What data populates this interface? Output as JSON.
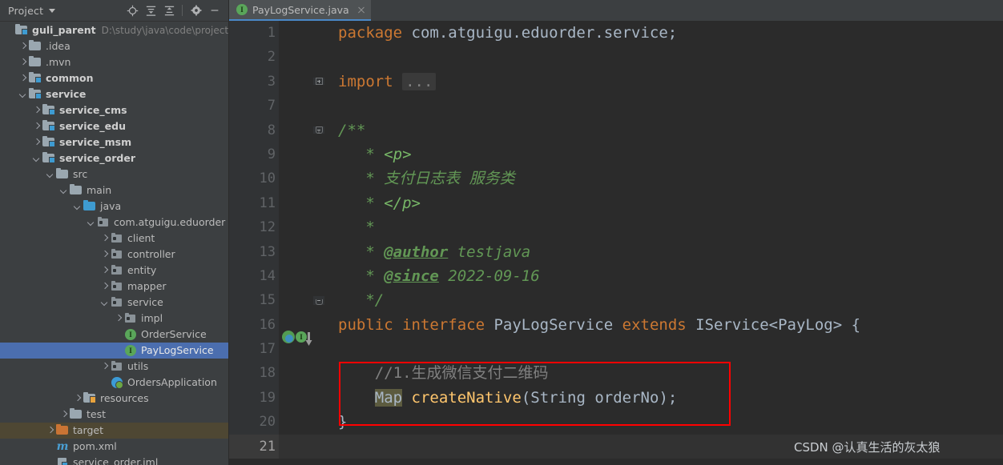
{
  "panel": {
    "title": "Project",
    "icons": [
      {
        "name": "locate-icon"
      },
      {
        "name": "expand-all-icon"
      },
      {
        "name": "collapse-all-icon"
      },
      {
        "name": "settings-gear-icon"
      },
      {
        "name": "minimize-icon"
      }
    ]
  },
  "tree": [
    {
      "label": "guli_parent",
      "path": "D:\\study\\java\\code\\project\\guli_",
      "indent": 0,
      "arrow": "none",
      "icon": "module-folder",
      "bold": true
    },
    {
      "label": ".idea",
      "indent": 1,
      "arrow": "right",
      "icon": "folder"
    },
    {
      "label": ".mvn",
      "indent": 1,
      "arrow": "right",
      "icon": "folder"
    },
    {
      "label": "common",
      "indent": 1,
      "arrow": "right",
      "icon": "module-folder",
      "bold": true
    },
    {
      "label": "service",
      "indent": 1,
      "arrow": "down",
      "icon": "module-folder",
      "bold": true
    },
    {
      "label": "service_cms",
      "indent": 2,
      "arrow": "right",
      "icon": "module-folder",
      "bold": true
    },
    {
      "label": "service_edu",
      "indent": 2,
      "arrow": "right",
      "icon": "module-folder",
      "bold": true
    },
    {
      "label": "service_msm",
      "indent": 2,
      "arrow": "right",
      "icon": "module-folder",
      "bold": true
    },
    {
      "label": "service_order",
      "indent": 2,
      "arrow": "down",
      "icon": "module-folder",
      "bold": true
    },
    {
      "label": "src",
      "indent": 3,
      "arrow": "down",
      "icon": "folder"
    },
    {
      "label": "main",
      "indent": 4,
      "arrow": "down",
      "icon": "folder"
    },
    {
      "label": "java",
      "indent": 5,
      "arrow": "down",
      "icon": "source-folder"
    },
    {
      "label": "com.atguigu.eduorder",
      "indent": 6,
      "arrow": "down",
      "icon": "package"
    },
    {
      "label": "client",
      "indent": 7,
      "arrow": "right",
      "icon": "package"
    },
    {
      "label": "controller",
      "indent": 7,
      "arrow": "right",
      "icon": "package"
    },
    {
      "label": "entity",
      "indent": 7,
      "arrow": "right",
      "icon": "package"
    },
    {
      "label": "mapper",
      "indent": 7,
      "arrow": "right",
      "icon": "package"
    },
    {
      "label": "service",
      "indent": 7,
      "arrow": "down",
      "icon": "package"
    },
    {
      "label": "impl",
      "indent": 8,
      "arrow": "right",
      "icon": "package"
    },
    {
      "label": "OrderService",
      "indent": 8,
      "arrow": "none",
      "icon": "interface"
    },
    {
      "label": "PayLogService",
      "indent": 8,
      "arrow": "none",
      "icon": "interface",
      "selected": true
    },
    {
      "label": "utils",
      "indent": 7,
      "arrow": "right",
      "icon": "package"
    },
    {
      "label": "OrdersApplication",
      "indent": 7,
      "arrow": "none",
      "icon": "spring-app"
    },
    {
      "label": "resources",
      "indent": 5,
      "arrow": "right",
      "icon": "resources-folder"
    },
    {
      "label": "test",
      "indent": 4,
      "arrow": "right",
      "icon": "folder"
    },
    {
      "label": "target",
      "indent": 3,
      "arrow": "right",
      "icon": "target-folder",
      "marked": true
    },
    {
      "label": "pom.xml",
      "indent": 3,
      "arrow": "none",
      "icon": "maven"
    },
    {
      "label": "service_order.iml",
      "indent": 3,
      "arrow": "none",
      "icon": "iml"
    }
  ],
  "tab": {
    "label": "PayLogService.java",
    "icon_char": "I",
    "close_label": "×"
  },
  "editor": {
    "lines": [
      {
        "num": "1",
        "fold": "none"
      },
      {
        "num": "2",
        "fold": "none"
      },
      {
        "num": "3",
        "fold": "plus"
      },
      {
        "num": "7",
        "fold": "none"
      },
      {
        "num": "8",
        "fold": "start"
      },
      {
        "num": "9",
        "fold": "line"
      },
      {
        "num": "10",
        "fold": "line"
      },
      {
        "num": "11",
        "fold": "line"
      },
      {
        "num": "12",
        "fold": "line"
      },
      {
        "num": "13",
        "fold": "line"
      },
      {
        "num": "14",
        "fold": "line"
      },
      {
        "num": "15",
        "fold": "end"
      },
      {
        "num": "16",
        "fold": "none",
        "gutter_icons": true
      },
      {
        "num": "17",
        "fold": "none"
      },
      {
        "num": "18",
        "fold": "none"
      },
      {
        "num": "19",
        "fold": "none"
      },
      {
        "num": "20",
        "fold": "none"
      },
      {
        "num": "21",
        "fold": "none",
        "current": true
      }
    ],
    "code": {
      "l1_kw": "package",
      "l1_rest": " com.atguigu.eduorder.service;",
      "l3_kw": "import",
      "l3_folded": "...",
      "l8": "/**",
      "l9_star": " * ",
      "l9_html": "<p>",
      "l10": " * 支付日志表 服务类",
      "l11_star": " * ",
      "l11_html": "</p>",
      "l12": " *",
      "l13_star": " * ",
      "l13_tag": "@author",
      "l13_rest": " testjava",
      "l14_star": " * ",
      "l14_tag": "@since",
      "l14_rest": " 2022-09-16",
      "l15": " */",
      "l16_kw1": "public",
      "l16_kw2": " interface",
      "l16_name": " PayLogService ",
      "l16_kw3": "extends",
      "l16_rest": " IService<PayLog> {",
      "l18_comment": "//1.生成微信支付二维码",
      "l19_type": "Map",
      "l19_space": " ",
      "l19_method": "createNative",
      "l19_paren1": "(",
      "l19_ptype": "String",
      "l19_pname": " orderNo",
      "l19_paren2": ");",
      "l20": "}"
    }
  },
  "watermark": {
    "text": "CSDN @认真生活的灰太狼"
  },
  "colors": {
    "accent_selection": "#4B6EAF",
    "marked_row": "#4E4733",
    "editor_bg": "#2B2B2B",
    "panel_bg": "#3C3F41",
    "highlight_box": "#FF0000",
    "keyword": "#CC7832",
    "comment": "#629755",
    "method": "#FFC66D",
    "line_comment": "#808080"
  }
}
